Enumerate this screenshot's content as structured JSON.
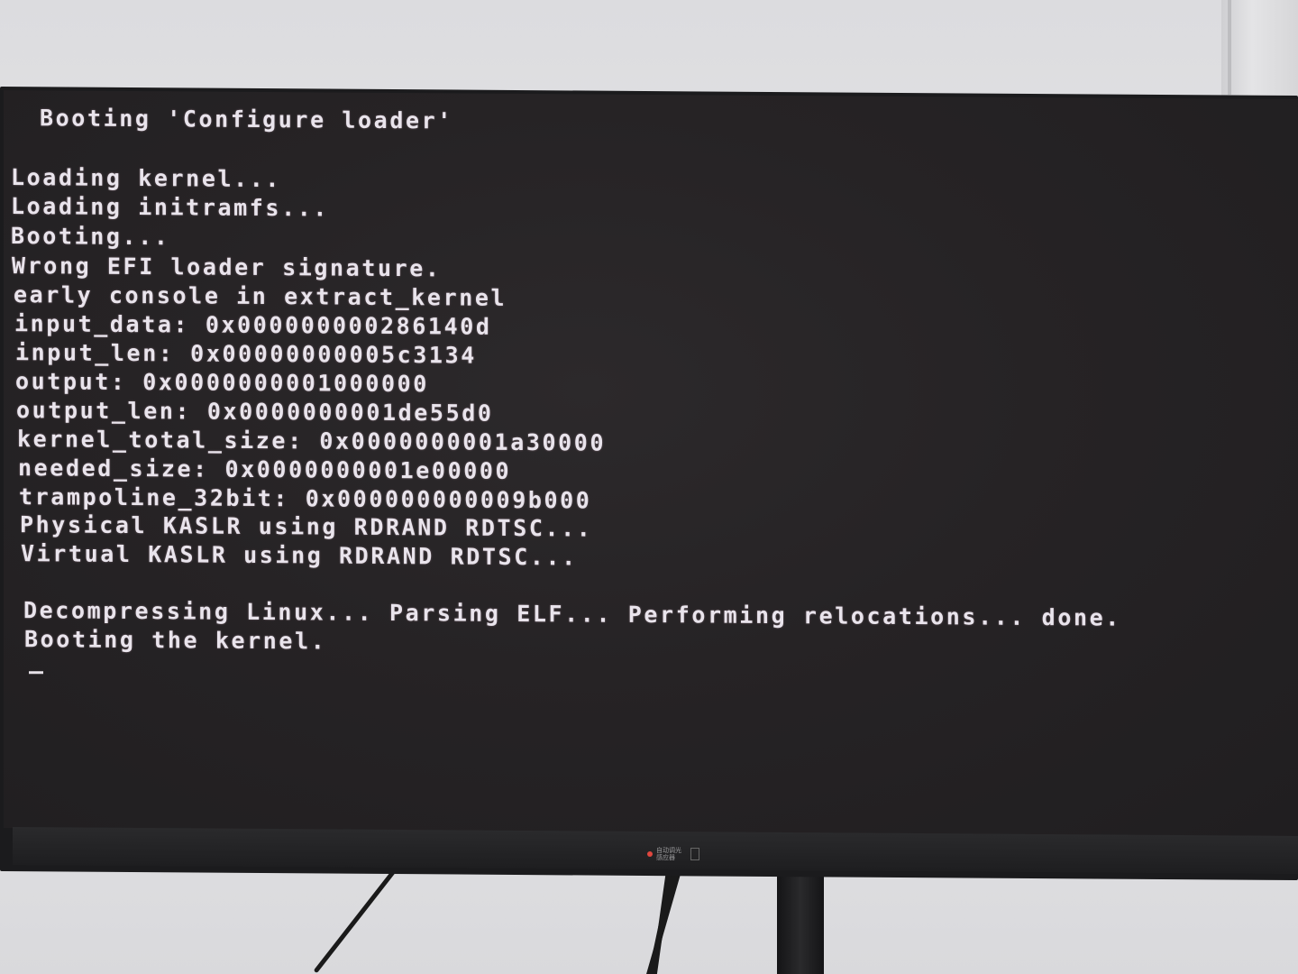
{
  "terminal": {
    "header": "Booting 'Configure loader'",
    "lines": [
      "Loading kernel...",
      "Loading initramfs...",
      "Booting...",
      "Wrong EFI loader signature.",
      "early console in extract_kernel",
      "input_data: 0x000000000286140d",
      "input_len: 0x00000000005c3134",
      "output: 0x0000000001000000",
      "output_len: 0x0000000001de55d0",
      "kernel_total_size: 0x0000000001a30000",
      "needed_size: 0x0000000001e00000",
      "trampoline_32bit: 0x000000000009b000",
      "Physical KASLR using RDRAND RDTSC...",
      "Virtual KASLR using RDRAND RDTSC...",
      "Decompressing Linux... Parsing ELF... Performing relocations... done.",
      "Booting the kernel."
    ],
    "cursor": "_"
  },
  "monitor": {
    "sensor_label_line1": "自动调光",
    "sensor_label_line2": "感应器"
  },
  "colors": {
    "screen_bg": "#262325",
    "text": "#e9e4ec",
    "bezel": "#1b1b1d",
    "wall": "#e2e2e4"
  }
}
